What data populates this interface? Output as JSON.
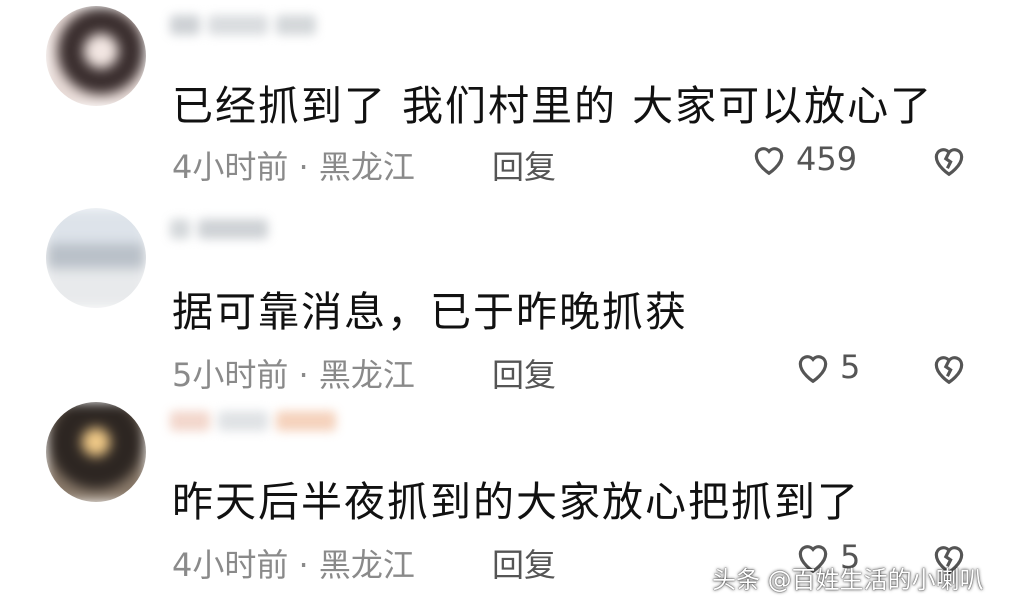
{
  "comments": [
    {
      "text": "已经抓到了  我们村里的  大家可以放心了",
      "meta": "4小时前 · 黑龙江",
      "reply_label": "回复",
      "likes": "459"
    },
    {
      "text": "据可靠消息，已于昨晚抓获",
      "meta": "5小时前 · 黑龙江",
      "reply_label": "回复",
      "likes": "5"
    },
    {
      "text": "昨天后半夜抓到的大家放心把抓到了",
      "meta": "4小时前 · 黑龙江",
      "reply_label": "回复",
      "likes": "5"
    }
  ],
  "icons": {
    "like": "heart-outline-icon",
    "dislike": "broken-heart-icon"
  },
  "colors": {
    "text": "#111111",
    "meta": "#8a8a8a",
    "icon": "#555555"
  },
  "watermark": "头条 @百姓生活的小喇叭"
}
